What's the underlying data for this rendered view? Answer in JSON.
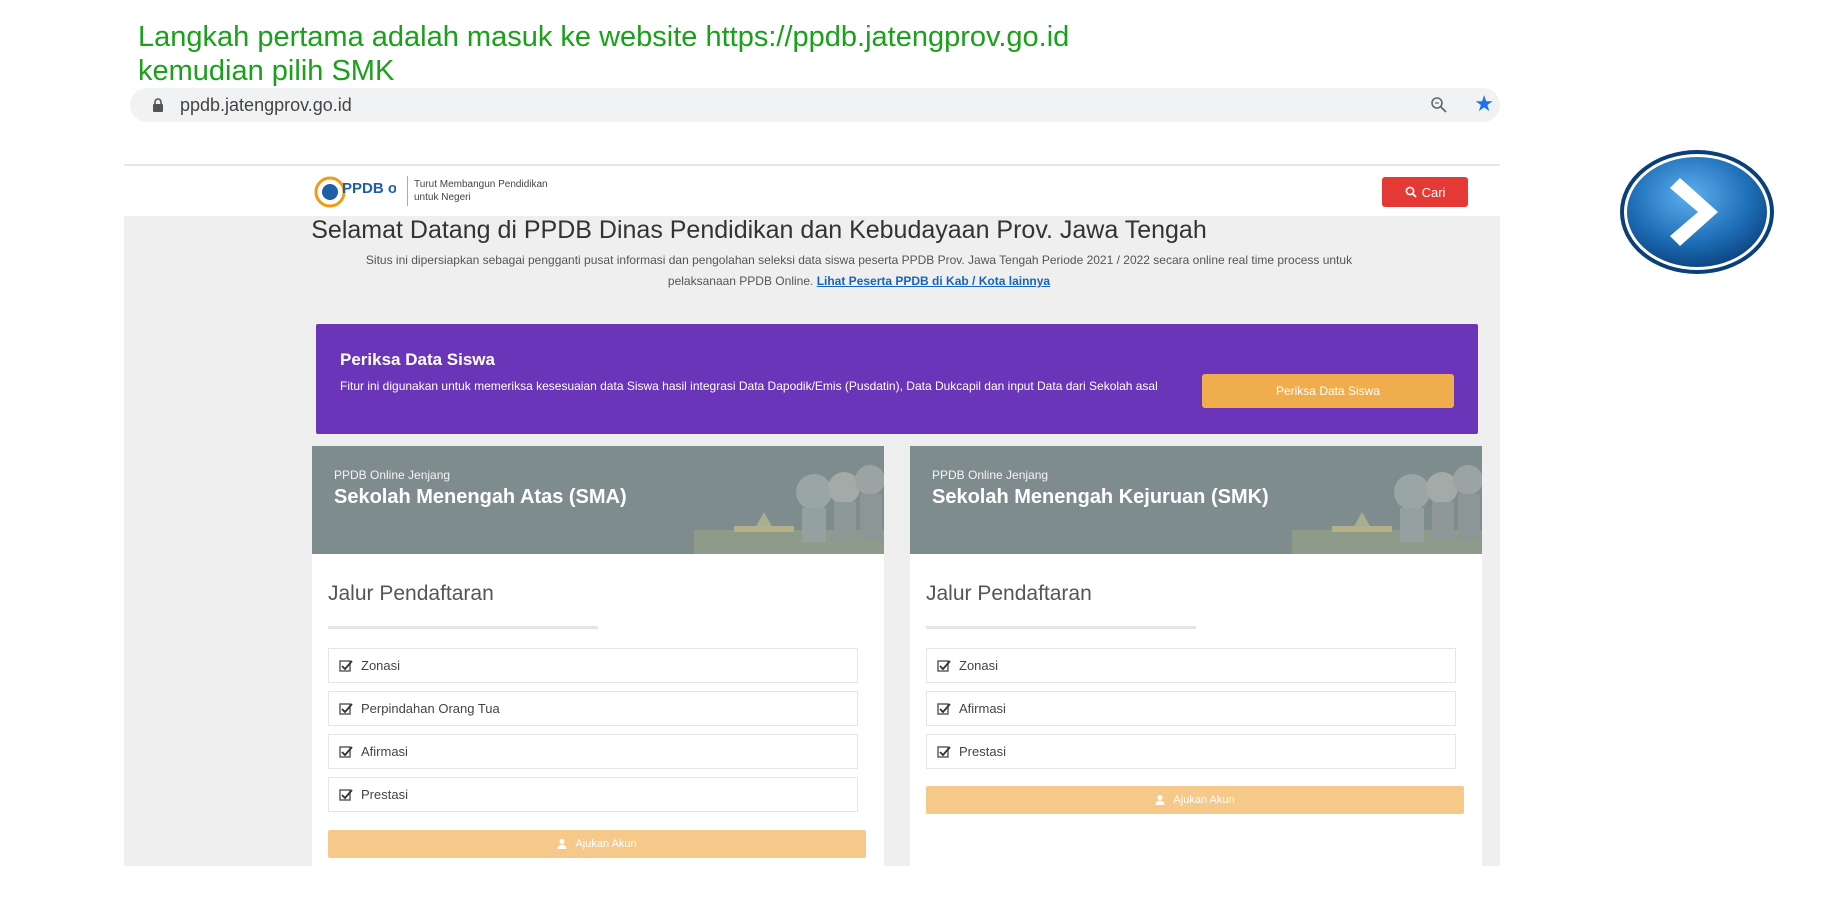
{
  "instruction": {
    "line1": "Langkah pertama adalah masuk ke website https://ppdb.jatengprov.go.id",
    "line2": "kemudian pilih SMK"
  },
  "browser": {
    "url": "ppdb.jatengprov.go.id"
  },
  "site": {
    "logo_text": "PPDB online",
    "tagline": "Turut Membangun Pendidikan untuk Negeri",
    "search_label": "Cari",
    "welcome": "Selamat Datang di PPDB Dinas Pendidikan dan Kebudayaan Prov. Jawa Tengah",
    "description": "Situs ini dipersiapkan sebagai pengganti pusat informasi dan pengolahan seleksi data siswa peserta PPDB Prov. Jawa Tengah Periode 2021 / 2022 secara online real time process untuk pelaksanaan PPDB Online.",
    "description_link": "Lihat Peserta PPDB di Kab / Kota lainnya"
  },
  "banner": {
    "title": "Periksa Data Siswa",
    "description": "Fitur ini digunakan untuk memeriksa kesesuaian data Siswa hasil integrasi Data Dapodik/Emis (Pusdatin), Data Dukcapil dan input Data dari Sekolah asal",
    "button_label": "Periksa Data Siswa"
  },
  "cards": {
    "sma": {
      "subtitle": "PPDB Online Jenjang",
      "title": "Sekolah Menengah Atas (SMA)",
      "section_title": "Jalur Pendaftaran",
      "items": [
        "Zonasi",
        "Perpindahan Orang Tua",
        "Afirmasi",
        "Prestasi"
      ],
      "button_label": "Ajukan Akun"
    },
    "smk": {
      "subtitle": "PPDB Online Jenjang",
      "title": "Sekolah Menengah Kejuruan (SMK)",
      "section_title": "Jalur Pendaftaran",
      "items": [
        "Zonasi",
        "Afirmasi",
        "Prestasi"
      ],
      "button_label": "Ajukan Akun"
    }
  },
  "colors": {
    "instruction_green": "#1aa01a",
    "banner_purple": "#6a35b8",
    "accent_orange": "#f0ad4e",
    "search_red": "#e53935",
    "card_header_gray": "#7f8c8d",
    "next_button_blue": "#1e6fb8"
  },
  "icons": {
    "address_bar": [
      "lock-icon",
      "zoom-icon",
      "star-icon"
    ],
    "search_button": "search-icon",
    "list_item": "check-icon",
    "card_button": "user-add-icon",
    "navigation": "chevron-right-icon"
  }
}
